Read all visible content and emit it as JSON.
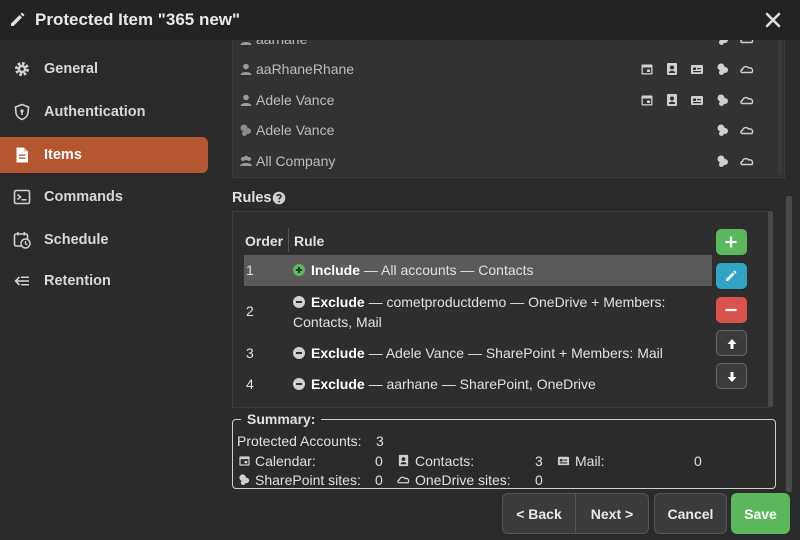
{
  "window": {
    "title": "Protected Item \"365 new\""
  },
  "sidebar": {
    "items": [
      {
        "label": "General",
        "icon": "gear-icon"
      },
      {
        "label": "Authentication",
        "icon": "shield-icon"
      },
      {
        "label": "Items",
        "icon": "document-icon",
        "active": true
      },
      {
        "label": "Commands",
        "icon": "terminal-icon"
      },
      {
        "label": "Schedule",
        "icon": "calendar-clock-icon"
      },
      {
        "label": "Retention",
        "icon": "arrow-left-icon"
      }
    ]
  },
  "accounts": [
    {
      "name": "aarhane",
      "type": "user"
    },
    {
      "name": "aaRhaneRhane",
      "type": "user"
    },
    {
      "name": "Adele Vance",
      "type": "user"
    },
    {
      "name": "Adele Vance",
      "type": "site"
    },
    {
      "name": "All Company",
      "type": "group"
    }
  ],
  "rules": {
    "label": "Rules",
    "columns": {
      "order": "Order",
      "rule": "Rule"
    },
    "rows": [
      {
        "order": "1",
        "action": "Include",
        "detail": " — All accounts — Contacts"
      },
      {
        "order": "2",
        "action": "Exclude",
        "detail": " — cometproductdemo — OneDrive + Members: Contacts, Mail"
      },
      {
        "order": "3",
        "action": "Exclude",
        "detail": " — Adele Vance — SharePoint + Members: Mail"
      },
      {
        "order": "4",
        "action": "Exclude",
        "detail": " — aarhane — SharePoint, OneDrive"
      }
    ],
    "selected_row": 0
  },
  "summary": {
    "legend": "Summary:",
    "protected_label": "Protected Accounts:",
    "protected_value": "3",
    "calendar_label": "Calendar:",
    "calendar_value": "0",
    "contacts_label": "Contacts:",
    "contacts_value": "3",
    "mail_label": "Mail:",
    "mail_value": "0",
    "sharepoint_label": "SharePoint sites:",
    "sharepoint_value": "0",
    "onedrive_label": "OneDrive sites:",
    "onedrive_value": "0"
  },
  "buttons": {
    "back": "< Back",
    "next": "Next >",
    "cancel": "Cancel",
    "save": "Save"
  },
  "colors": {
    "accent": "#b4562f",
    "save": "#5cb85c",
    "add": "#5cb85c",
    "edit": "#31a3c4",
    "remove": "#d9534f"
  }
}
